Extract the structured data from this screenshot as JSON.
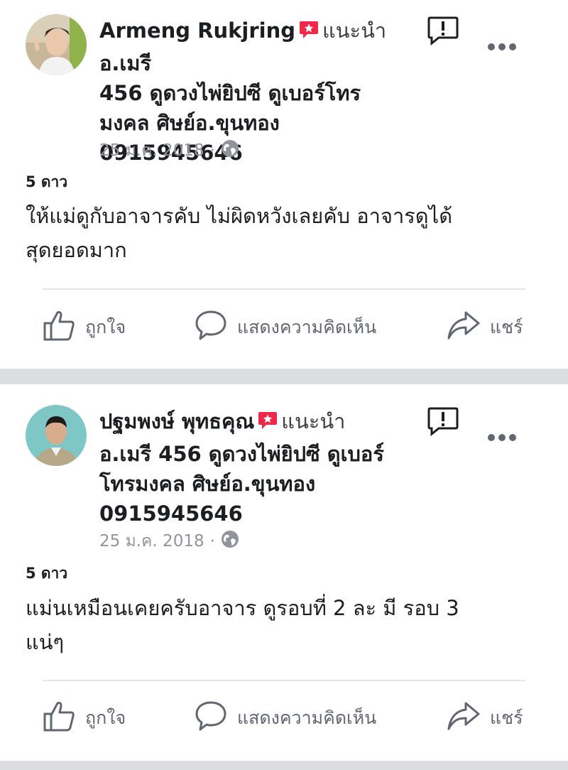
{
  "posts": [
    {
      "author": "Armeng Rukjring",
      "recommend_word": "แนะนำ",
      "page_line_1": "อ.เมรี",
      "page_line_2": "456 ดูดวงไพ่ยิปซี ดูเบอร์โทร",
      "page_line_3": "มงคล ศิษย์อ.ขุนทอง",
      "phone": "0915945646",
      "date": "25 ม.ค. 2018",
      "separator": "·",
      "rating": "5 ดาว",
      "text_line_1": "ให้แม่ดูกับอาจารคับ ไม่ผิดหวังเลยคับ อาจารดูได้",
      "text_line_2": "สุดยอดมาก",
      "avatar_icon": "user-avatar-photo"
    },
    {
      "author": "ปฐมพงษ์ พุทธคุณ",
      "recommend_word": "แนะนำ",
      "page_line_1": "อ.เมรี 456 ดูดวงไพ่ยิปซี ดูเบอร์",
      "page_line_2": "โทรมงคล ศิษย์อ.ขุนทอง",
      "phone": "0915945646",
      "date": "25 ม.ค. 2018",
      "separator": "·",
      "rating": "5 ดาว",
      "text_line_1": "แม่นเหมือนเคยครับอาจาร ดูรอบที่ 2 ละ มี รอบ 3",
      "text_line_2": "แน่ๆ",
      "avatar_icon": "user-avatar-photo"
    }
  ],
  "actions": {
    "like": "ถูกใจ",
    "comment": "แสดงความคิดเห็น",
    "share": "แชร์"
  },
  "colors": {
    "recommend_badge": "#f02849",
    "muted_text": "#606770",
    "meta_text": "#90949c",
    "divider": "#e4e6eb",
    "feed_background": "#dcdde1"
  }
}
